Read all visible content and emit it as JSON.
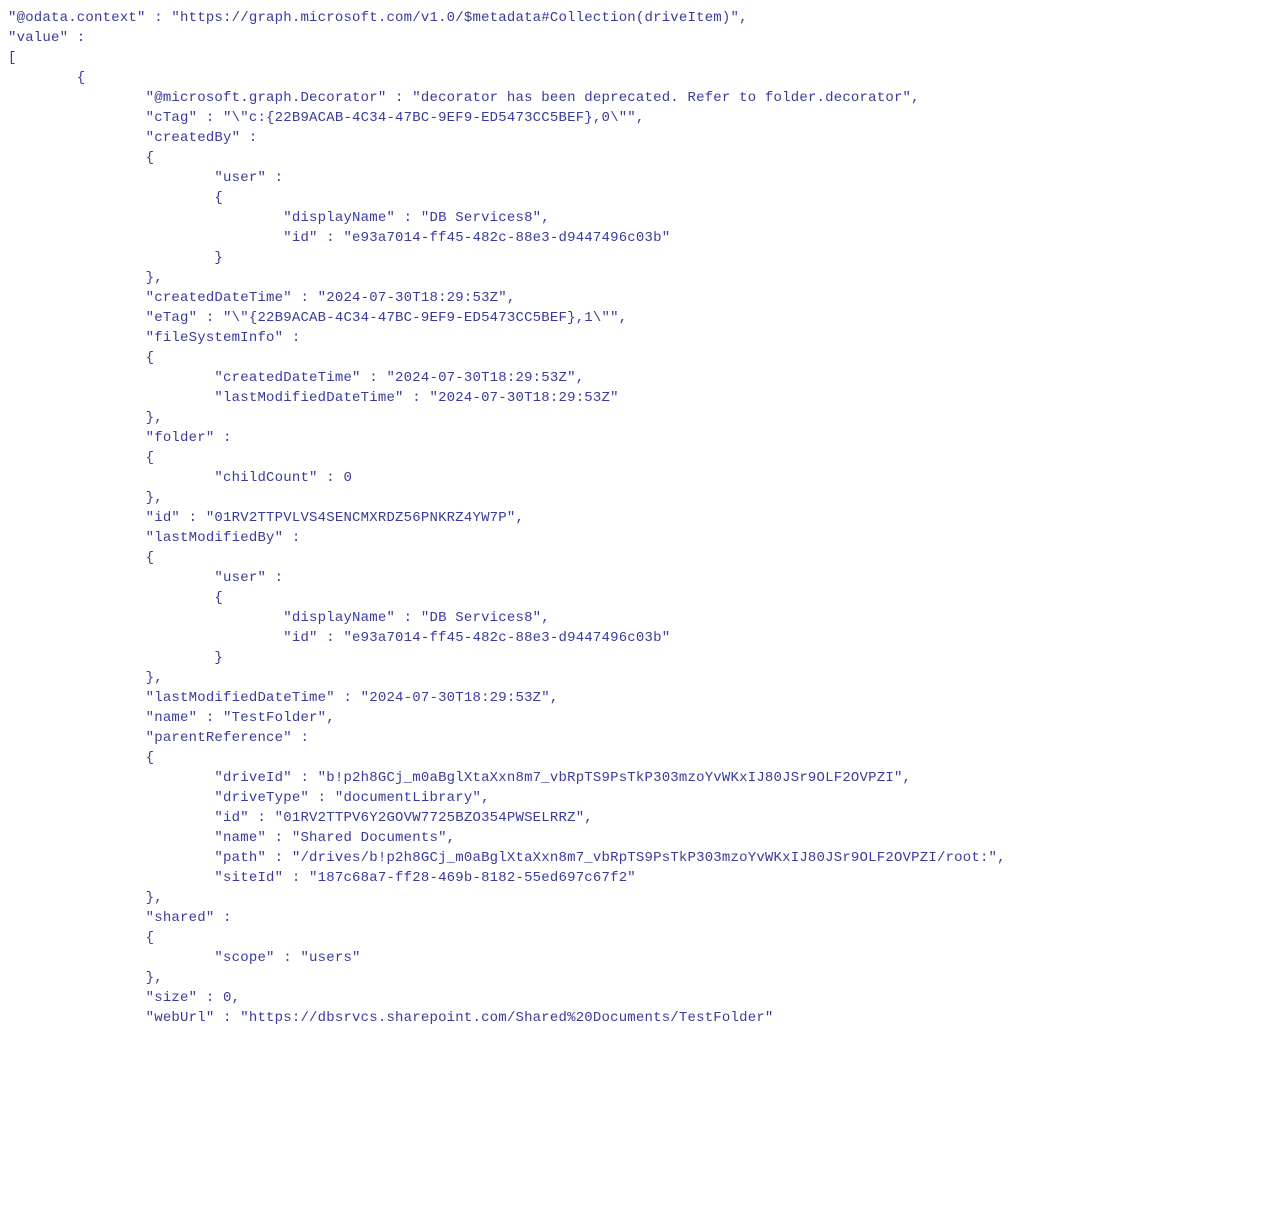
{
  "lines": [
    "\"@odata.context\" : \"https://graph.microsoft.com/v1.0/$metadata#Collection(driveItem)\",",
    "\"value\" :",
    "[",
    "        {",
    "                \"@microsoft.graph.Decorator\" : \"decorator has been deprecated. Refer to folder.decorator\",",
    "                \"cTag\" : \"\\\"c:{22B9ACAB-4C34-47BC-9EF9-ED5473CC5BEF},0\\\"\",",
    "                \"createdBy\" :",
    "                {",
    "                        \"user\" :",
    "                        {",
    "                                \"displayName\" : \"DB Services8\",",
    "                                \"id\" : \"e93a7014-ff45-482c-88e3-d9447496c03b\"",
    "                        }",
    "                },",
    "                \"createdDateTime\" : \"2024-07-30T18:29:53Z\",",
    "                \"eTag\" : \"\\\"{22B9ACAB-4C34-47BC-9EF9-ED5473CC5BEF},1\\\"\",",
    "                \"fileSystemInfo\" :",
    "                {",
    "                        \"createdDateTime\" : \"2024-07-30T18:29:53Z\",",
    "                        \"lastModifiedDateTime\" : \"2024-07-30T18:29:53Z\"",
    "                },",
    "                \"folder\" :",
    "                {",
    "                        \"childCount\" : 0",
    "                },",
    "                \"id\" : \"01RV2TTPVLVS4SENCMXRDZ56PNKRZ4YW7P\",",
    "                \"lastModifiedBy\" :",
    "                {",
    "                        \"user\" :",
    "                        {",
    "                                \"displayName\" : \"DB Services8\",",
    "                                \"id\" : \"e93a7014-ff45-482c-88e3-d9447496c03b\"",
    "                        }",
    "                },",
    "                \"lastModifiedDateTime\" : \"2024-07-30T18:29:53Z\",",
    "                \"name\" : \"TestFolder\",",
    "                \"parentReference\" :",
    "                {",
    "                        \"driveId\" : \"b!p2h8GCj_m0aBglXtaXxn8m7_vbRpTS9PsTkP303mzoYvWKxIJ80JSr9OLF2OVPZI\",",
    "                        \"driveType\" : \"documentLibrary\",",
    "                        \"id\" : \"01RV2TTPV6Y2GOVW7725BZO354PWSELRRZ\",",
    "                        \"name\" : \"Shared Documents\",",
    "                        \"path\" : \"/drives/b!p2h8GCj_m0aBglXtaXxn8m7_vbRpTS9PsTkP303mzoYvWKxIJ80JSr9OLF2OVPZI/root:\",",
    "                        \"siteId\" : \"187c68a7-ff28-469b-8182-55ed697c67f2\"",
    "                },",
    "                \"shared\" :",
    "                {",
    "                        \"scope\" : \"users\"",
    "                },",
    "                \"size\" : 0,",
    "                \"webUrl\" : \"https://dbsrvcs.sharepoint.com/Shared%20Documents/TestFolder\""
  ]
}
